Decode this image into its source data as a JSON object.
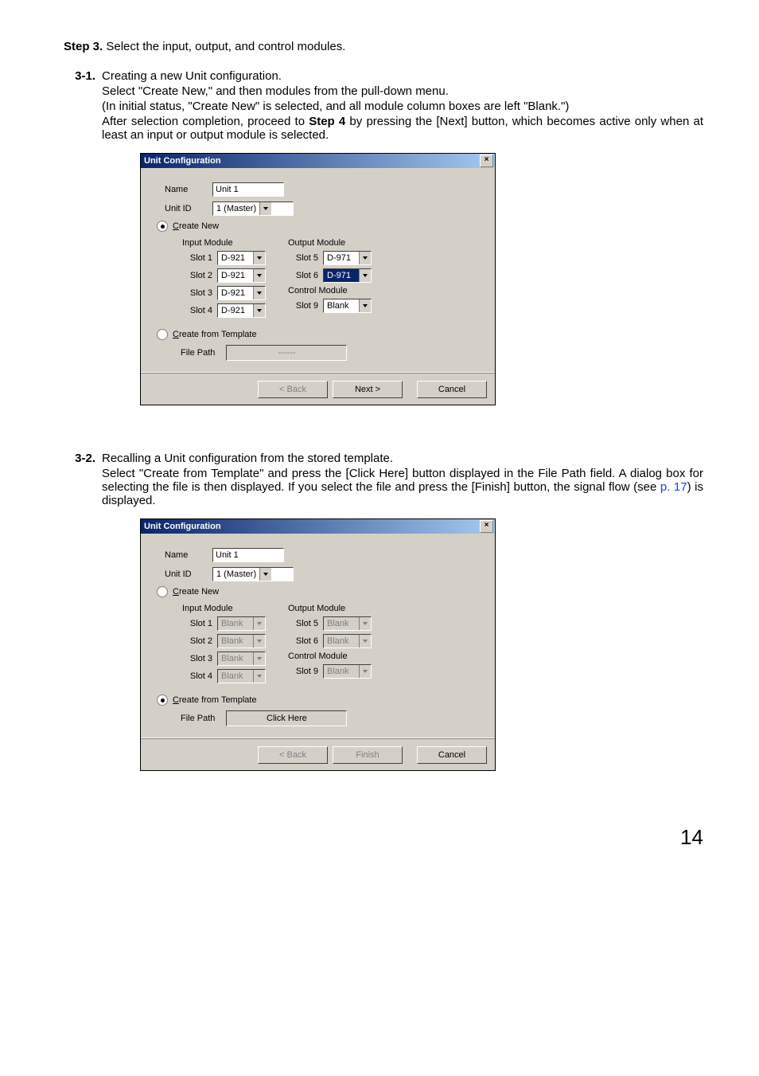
{
  "step": {
    "label": "Step 3.",
    "text": "Select the input, output, and control modules."
  },
  "sec31": {
    "num": "3-1.",
    "title": "Creating a new Unit configuration.",
    "p1": "Select \"Create New,\" and then modules from the pull-down menu.",
    "p2": "(In initial status, \"Create New\" is selected, and all module column boxes are left \"Blank.\")",
    "p3a": "After selection completion, proceed to ",
    "p3bold": "Step 4",
    "p3b": " by pressing the [Next] button, which becomes active only when at least an input or output module is selected."
  },
  "sec32": {
    "num": "3-2.",
    "title": "Recalling a Unit configuration from the stored template.",
    "p1a": "Select \"Create from Template\" and press the [Click Here] button displayed in the File Path field. A dialog box for selecting the file is then displayed. If you select the file and press the [Finish] button, the signal flow (see ",
    "link": "p. 17",
    "p1b": ") is displayed."
  },
  "dlg": {
    "title": "Unit Configuration",
    "close": "×",
    "nameLabel": "Name",
    "nameValue": "Unit 1",
    "unitIdLabel": "Unit ID",
    "unitIdValue": "1 (Master)",
    "createNew": "Create New",
    "inputModule": "Input Module",
    "outputModule": "Output Module",
    "controlModule": "Control Module",
    "slot1": "Slot 1",
    "slot2": "Slot 2",
    "slot3": "Slot 3",
    "slot4": "Slot 4",
    "slot5": "Slot 5",
    "slot6": "Slot 6",
    "slot9": "Slot 9",
    "d921": "D-921",
    "d971": "D-971",
    "blank": "Blank",
    "createFromTemplate": "Create from Template",
    "filePath": "File Path",
    "filePlaceholder": "------",
    "clickHere": "Click Here",
    "back": "< Back",
    "next": "Next >",
    "finish": "Finish",
    "cancel": "Cancel"
  },
  "pageNumber": "14"
}
